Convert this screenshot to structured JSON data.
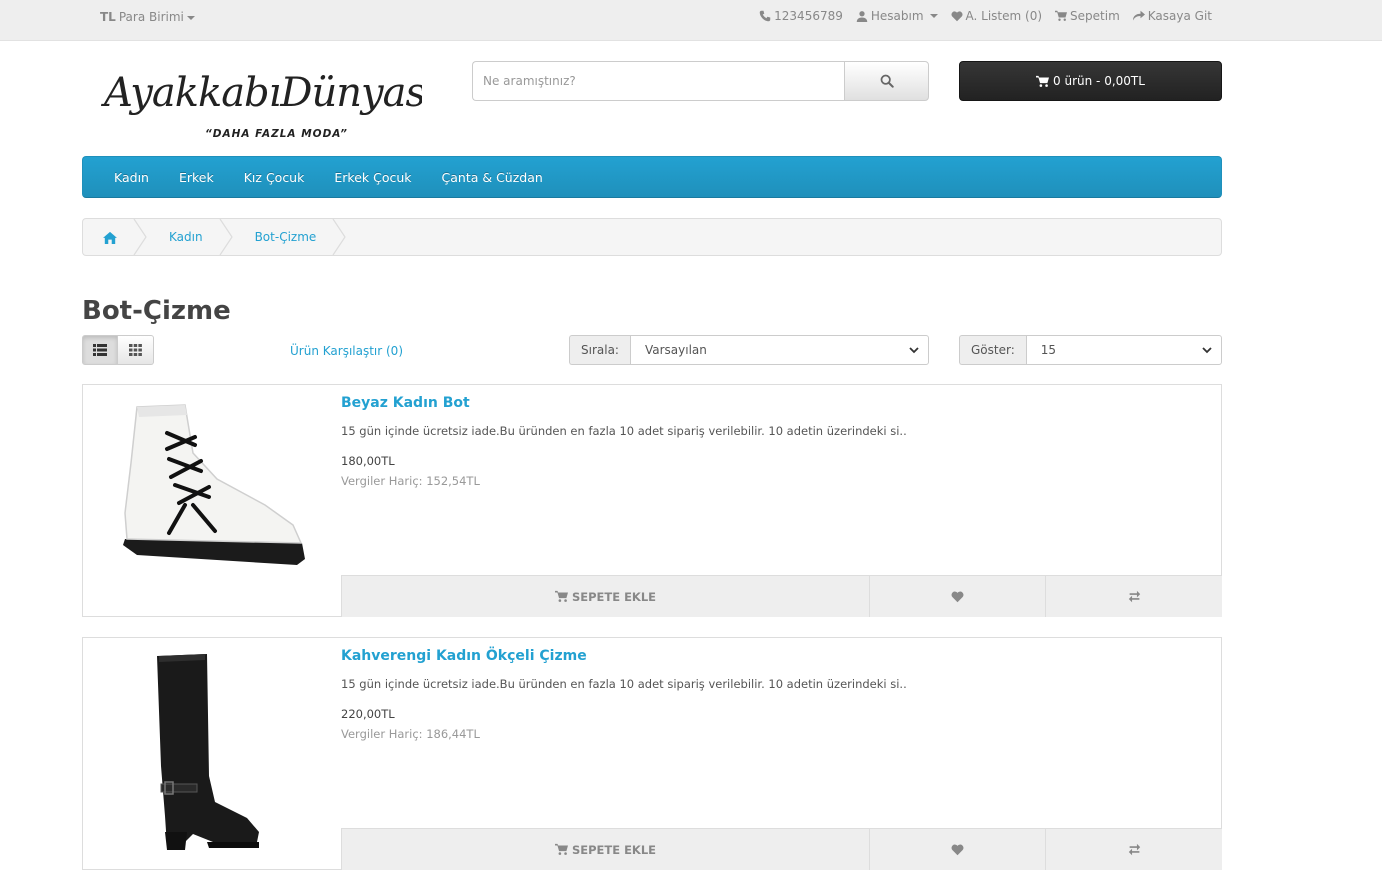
{
  "topbar": {
    "currency_symbol": "TL",
    "currency_label": "Para Birimi",
    "phone": "123456789",
    "account": "Hesabım",
    "wishlist": "A. Listem (0)",
    "cart": "Sepetim",
    "checkout": "Kasaya Git"
  },
  "header": {
    "logo_text": "AyakkabıDünyası",
    "logo_tagline": "“DAHA FAZLA MODA”",
    "search_placeholder": "Ne aramıştınız?",
    "cart_summary": "0 ürün - 0,00TL"
  },
  "menu": [
    "Kadın",
    "Erkek",
    "Kız Çocuk",
    "Erkek Çocuk",
    "Çanta & Cüzdan"
  ],
  "breadcrumb": [
    "Kadın",
    "Bot-Çizme"
  ],
  "page": {
    "title": "Bot-Çizme",
    "compare": "Ürün Karşılaştır (0)",
    "sort_label": "Sırala:",
    "sort_value": "Varsayılan",
    "show_label": "Göster:",
    "show_value": "15"
  },
  "products": [
    {
      "name": "Beyaz Kadın Bot",
      "description": "15 gün içinde ücretsiz iade.Bu üründen en fazla 10 adet sipariş verilebilir. 10 adetin üzerindeki si..",
      "price": "180,00TL",
      "tax": "Vergiler Hariç: 152,54TL",
      "add_to_cart": "SEPETE EKLE"
    },
    {
      "name": "Kahverengi Kadın Ökçeli Çizme",
      "description": "15 gün içinde ücretsiz iade.Bu üründen en fazla 10 adet sipariş verilebilir. 10 adetin üzerindeki si..",
      "price": "220,00TL",
      "tax": "Vergiler Hariç: 186,44TL",
      "add_to_cart": "SEPETE EKLE"
    }
  ],
  "colors": {
    "accent": "#23a1d1",
    "cart_button": "#2b2b2b"
  }
}
